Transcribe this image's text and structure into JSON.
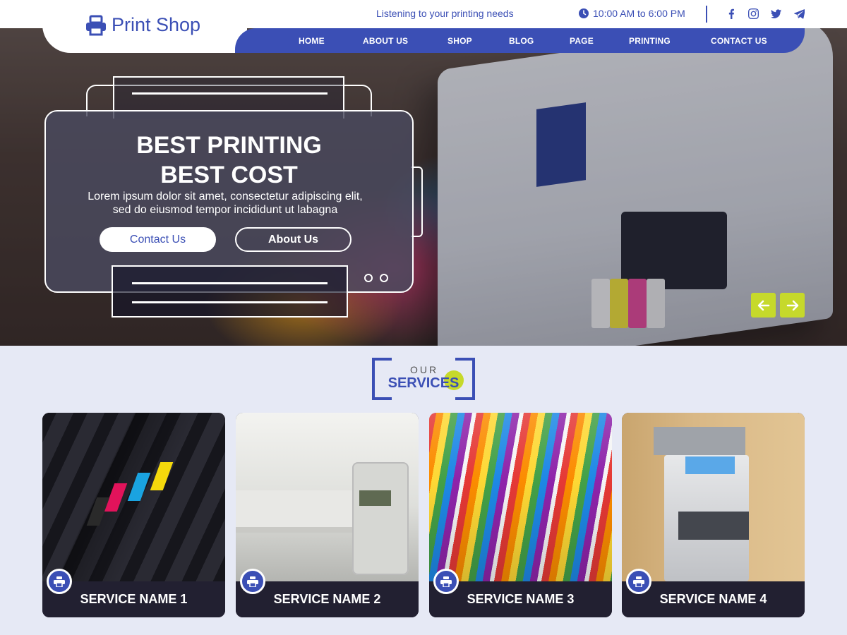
{
  "header": {
    "brand": "Print Shop",
    "tagline": "Listening to your printing needs",
    "hours": "10:00 AM to 6:00 PM",
    "social_icons": [
      "facebook-icon",
      "instagram-icon",
      "twitter-icon",
      "telegram-icon"
    ]
  },
  "nav": {
    "items": [
      {
        "label": "HOME"
      },
      {
        "label": "ABOUT US"
      },
      {
        "label": "SHOP"
      },
      {
        "label": "BLOG"
      },
      {
        "label": "PAGE"
      },
      {
        "label": "PRINTING"
      },
      {
        "label": "CONTACT US"
      }
    ]
  },
  "hero": {
    "title_line1": "BEST PRINTING",
    "title_line2": "BEST COST",
    "description": "Lorem ipsum dolor sit amet, consectetur adipiscing elit, sed do eiusmod tempor incididunt ut labagna",
    "contact_label": "Contact Us",
    "about_label": "About Us",
    "slide_dots": 2,
    "prev_icon": "arrow-left-icon",
    "next_icon": "arrow-right-icon"
  },
  "services": {
    "heading_small": "OUR",
    "heading_big": "SERVICES",
    "items": [
      {
        "name": "SERVICE NAME 1",
        "icon": "printer-icon"
      },
      {
        "name": "SERVICE NAME 2",
        "icon": "printer-icon"
      },
      {
        "name": "SERVICE NAME 3",
        "icon": "printer-icon"
      },
      {
        "name": "SERVICE NAME 4",
        "icon": "printer-icon"
      }
    ]
  },
  "colors": {
    "primary": "#3b4fb5",
    "accent": "#c6d92b",
    "dark": "#222031",
    "background": "#e6e9f5"
  }
}
